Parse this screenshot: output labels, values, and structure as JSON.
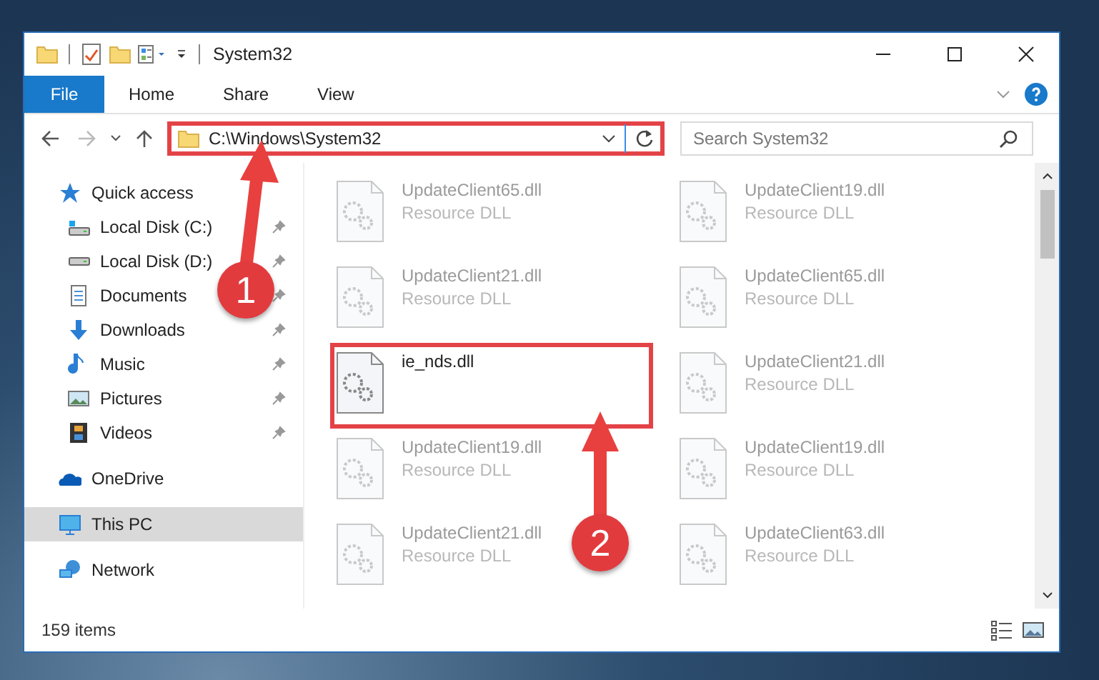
{
  "window": {
    "title": "System32"
  },
  "ribbon_tabs": [
    {
      "label": "File",
      "kind": "file"
    },
    {
      "label": "Home",
      "kind": "tab"
    },
    {
      "label": "Share",
      "kind": "tab"
    },
    {
      "label": "View",
      "kind": "tab"
    }
  ],
  "address_bar": {
    "path": "C:\\Windows\\System32",
    "highlighted": true
  },
  "search": {
    "placeholder": "Search System32"
  },
  "sidebar": {
    "items": [
      {
        "label": "Quick access",
        "kind": "star",
        "selected": false,
        "children": [
          {
            "label": "Local Disk (C:)",
            "kind": "drive-c",
            "pinned": true
          },
          {
            "label": "Local Disk (D:)",
            "kind": "drive",
            "pinned": true
          },
          {
            "label": "Documents",
            "kind": "documents",
            "pinned": true
          },
          {
            "label": "Downloads",
            "kind": "downloads",
            "pinned": true
          },
          {
            "label": "Music",
            "kind": "music",
            "pinned": true
          },
          {
            "label": "Pictures",
            "kind": "pictures",
            "pinned": true
          },
          {
            "label": "Videos",
            "kind": "videos",
            "pinned": true
          }
        ]
      },
      {
        "label": "OneDrive",
        "kind": "cloud",
        "selected": false
      },
      {
        "label": "This PC",
        "kind": "pc",
        "selected": true
      },
      {
        "label": "Network",
        "kind": "network",
        "selected": false
      }
    ]
  },
  "files": [
    {
      "name": "UpdateClient65.dll",
      "type": "Resource DLL",
      "faded": true,
      "highlighted": false
    },
    {
      "name": "UpdateClient19.dll",
      "type": "Resource DLL",
      "faded": true,
      "highlighted": false
    },
    {
      "name": "UpdateClient21.dll",
      "type": "Resource DLL",
      "faded": true,
      "highlighted": false
    },
    {
      "name": "UpdateClient65.dll",
      "type": "Resource DLL",
      "faded": true,
      "highlighted": false
    },
    {
      "name": "ie_nds.dll",
      "faded": false,
      "highlighted": true
    },
    {
      "name": "UpdateClient21.dll",
      "type": "Resource DLL",
      "faded": true,
      "highlighted": false
    },
    {
      "name": "UpdateClient19.dll",
      "type": "Resource DLL",
      "faded": true,
      "highlighted": false
    },
    {
      "name": "UpdateClient19.dll",
      "type": "Resource DLL",
      "faded": true,
      "highlighted": false
    },
    {
      "name": "UpdateClient21.dll",
      "type": "Resource DLL",
      "faded": true,
      "highlighted": false
    },
    {
      "name": "UpdateClient63.dll",
      "type": "Resource DLL",
      "faded": true,
      "highlighted": false
    }
  ],
  "status_bar": {
    "item_count": "159 items"
  },
  "callouts": [
    {
      "number": "1"
    },
    {
      "number": "2"
    }
  ]
}
